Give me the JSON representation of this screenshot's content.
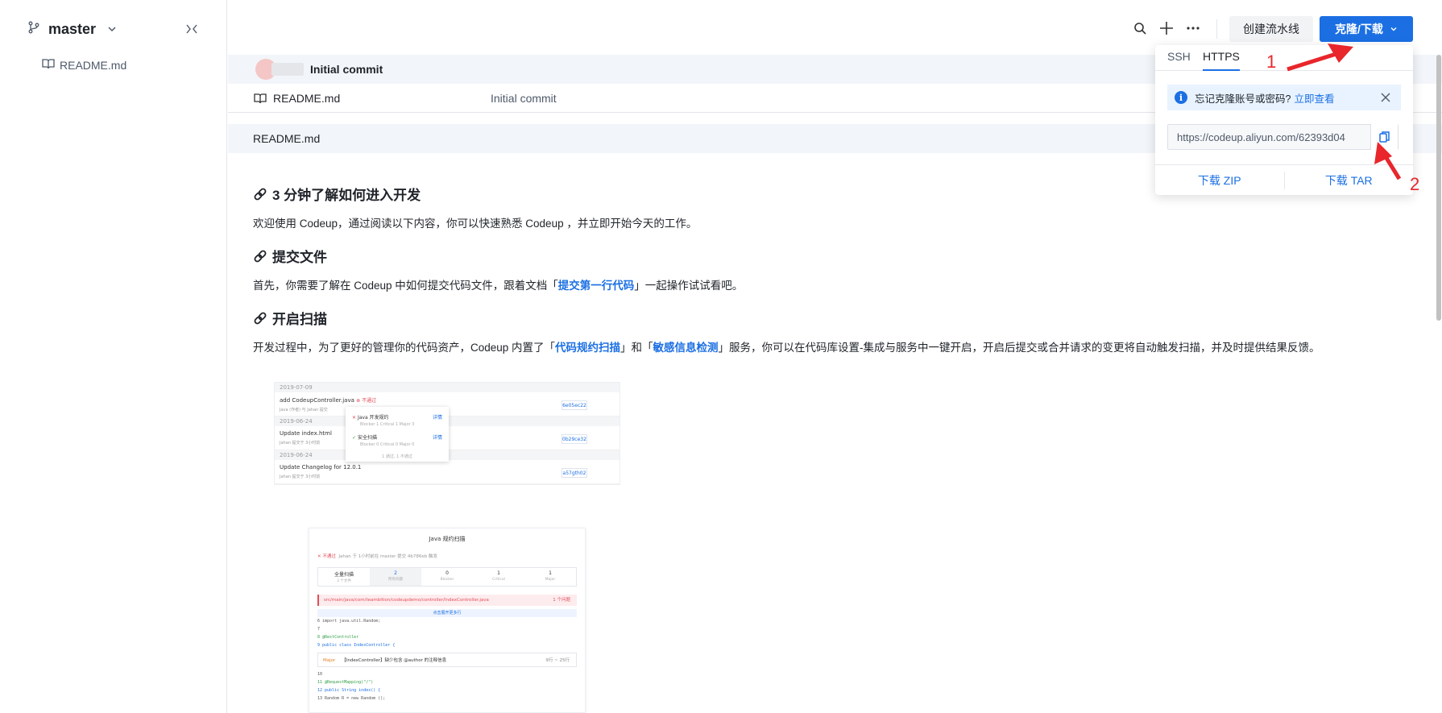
{
  "sidebar": {
    "branch": "master",
    "files": [
      "README.md"
    ]
  },
  "toolbar": {
    "create_pipeline": "创建流水线",
    "clone_download": "克隆/下载"
  },
  "commit": {
    "message": "Initial commit"
  },
  "file_list": [
    {
      "name": "README.md",
      "commit": "Initial commit"
    }
  ],
  "readme": {
    "header": "README.md",
    "sections": [
      {
        "title": "3 分钟了解如何进入开发",
        "text": "欢迎使用 Codeup，通过阅读以下内容，你可以快速熟悉 Codeup ，并立即开始今天的工作。"
      },
      {
        "title": "提交文件",
        "text_before": "首先，你需要了解在 Codeup 中如何提交代码文件，跟着文档「",
        "link": "提交第一行代码",
        "text_after": "」一起操作试试看吧。"
      },
      {
        "title": "开启扫描",
        "text_before": "开发过程中，为了更好的管理你的代码资产，Codeup 内置了「",
        "link1": "代码规约扫描",
        "text_mid": "」和「",
        "link2": "敏感信息检测",
        "text_after": "」服务，你可以在代码库设置-集成与服务中一键开启，开启后提交或合并请求的变更将自动触发扫描，并及时提供结果反馈。"
      }
    ],
    "screenshot1": {
      "dates": [
        "2019-07-09",
        "2019-06-24",
        "2019-06-24"
      ],
      "commits": [
        {
          "title": "add CodeupController.java",
          "badge": "不通过",
          "meta": "Java (作者) 与 Jahan  提交",
          "hash": "6e05ec22"
        },
        {
          "title": "Update index.html",
          "meta": "Jahan  提交于 3小时前",
          "hash": "0b29ce32"
        },
        {
          "title": "Update Changelog for 12.0.1",
          "meta": "Jahan  提交于 3小时前",
          "hash": "a57gth02"
        }
      ],
      "popup": [
        {
          "name": "Java 开发规约",
          "detail": "Blocker 1 Critical 1 Major 3",
          "link": "详情"
        },
        {
          "name": "安全扫描",
          "detail": "Blocker 0 Critical 0 Major 0",
          "link": "详情"
        }
      ],
      "popup_footer": "1 通过, 1 不通过"
    },
    "screenshot2": {
      "title": "Java 规约扫描",
      "meta_badge": "不通过",
      "meta": "Jahan 于 1小时前在 master 提交 4b786eb 触发",
      "stats": [
        {
          "value": "全量扫描",
          "label": "3 个文件"
        },
        {
          "value": "2",
          "label": "所有问题"
        },
        {
          "value": "0",
          "label": "Blocker"
        },
        {
          "value": "1",
          "label": "Critical"
        },
        {
          "value": "1",
          "label": "Major"
        }
      ],
      "path": "src/main/java/com/teambition/codeupdemo/controller/IndexController.java",
      "path_right": "1 个问题",
      "expand": "点击展开更多行",
      "code_lines": [
        "6   import java.util.Random;",
        "7",
        "8   @RestController",
        "9   public class IndexController {"
      ],
      "issue_tag": "Major",
      "issue": "【IndexController】缺少包含 @author 的注释信息",
      "issue_right": "9行 ~ 25行",
      "code_lines2": [
        "10",
        "11      @RequestMapping(\"/\")",
        "12      public String index() {",
        "13          Random R = new Random ();"
      ]
    }
  },
  "clone_panel": {
    "tabs": [
      "SSH",
      "HTTPS"
    ],
    "active_tab": "HTTPS",
    "notice": "忘记克隆账号或密码?",
    "notice_link": "立即查看",
    "url": "https://codeup.aliyun.com/62393d04",
    "download_zip": "下载 ZIP",
    "download_tar": "下载 TAR"
  },
  "annotations": {
    "first": "1",
    "second": "2"
  },
  "colors": {
    "accent": "#1b6fe3",
    "annotation": "#e8262b"
  }
}
